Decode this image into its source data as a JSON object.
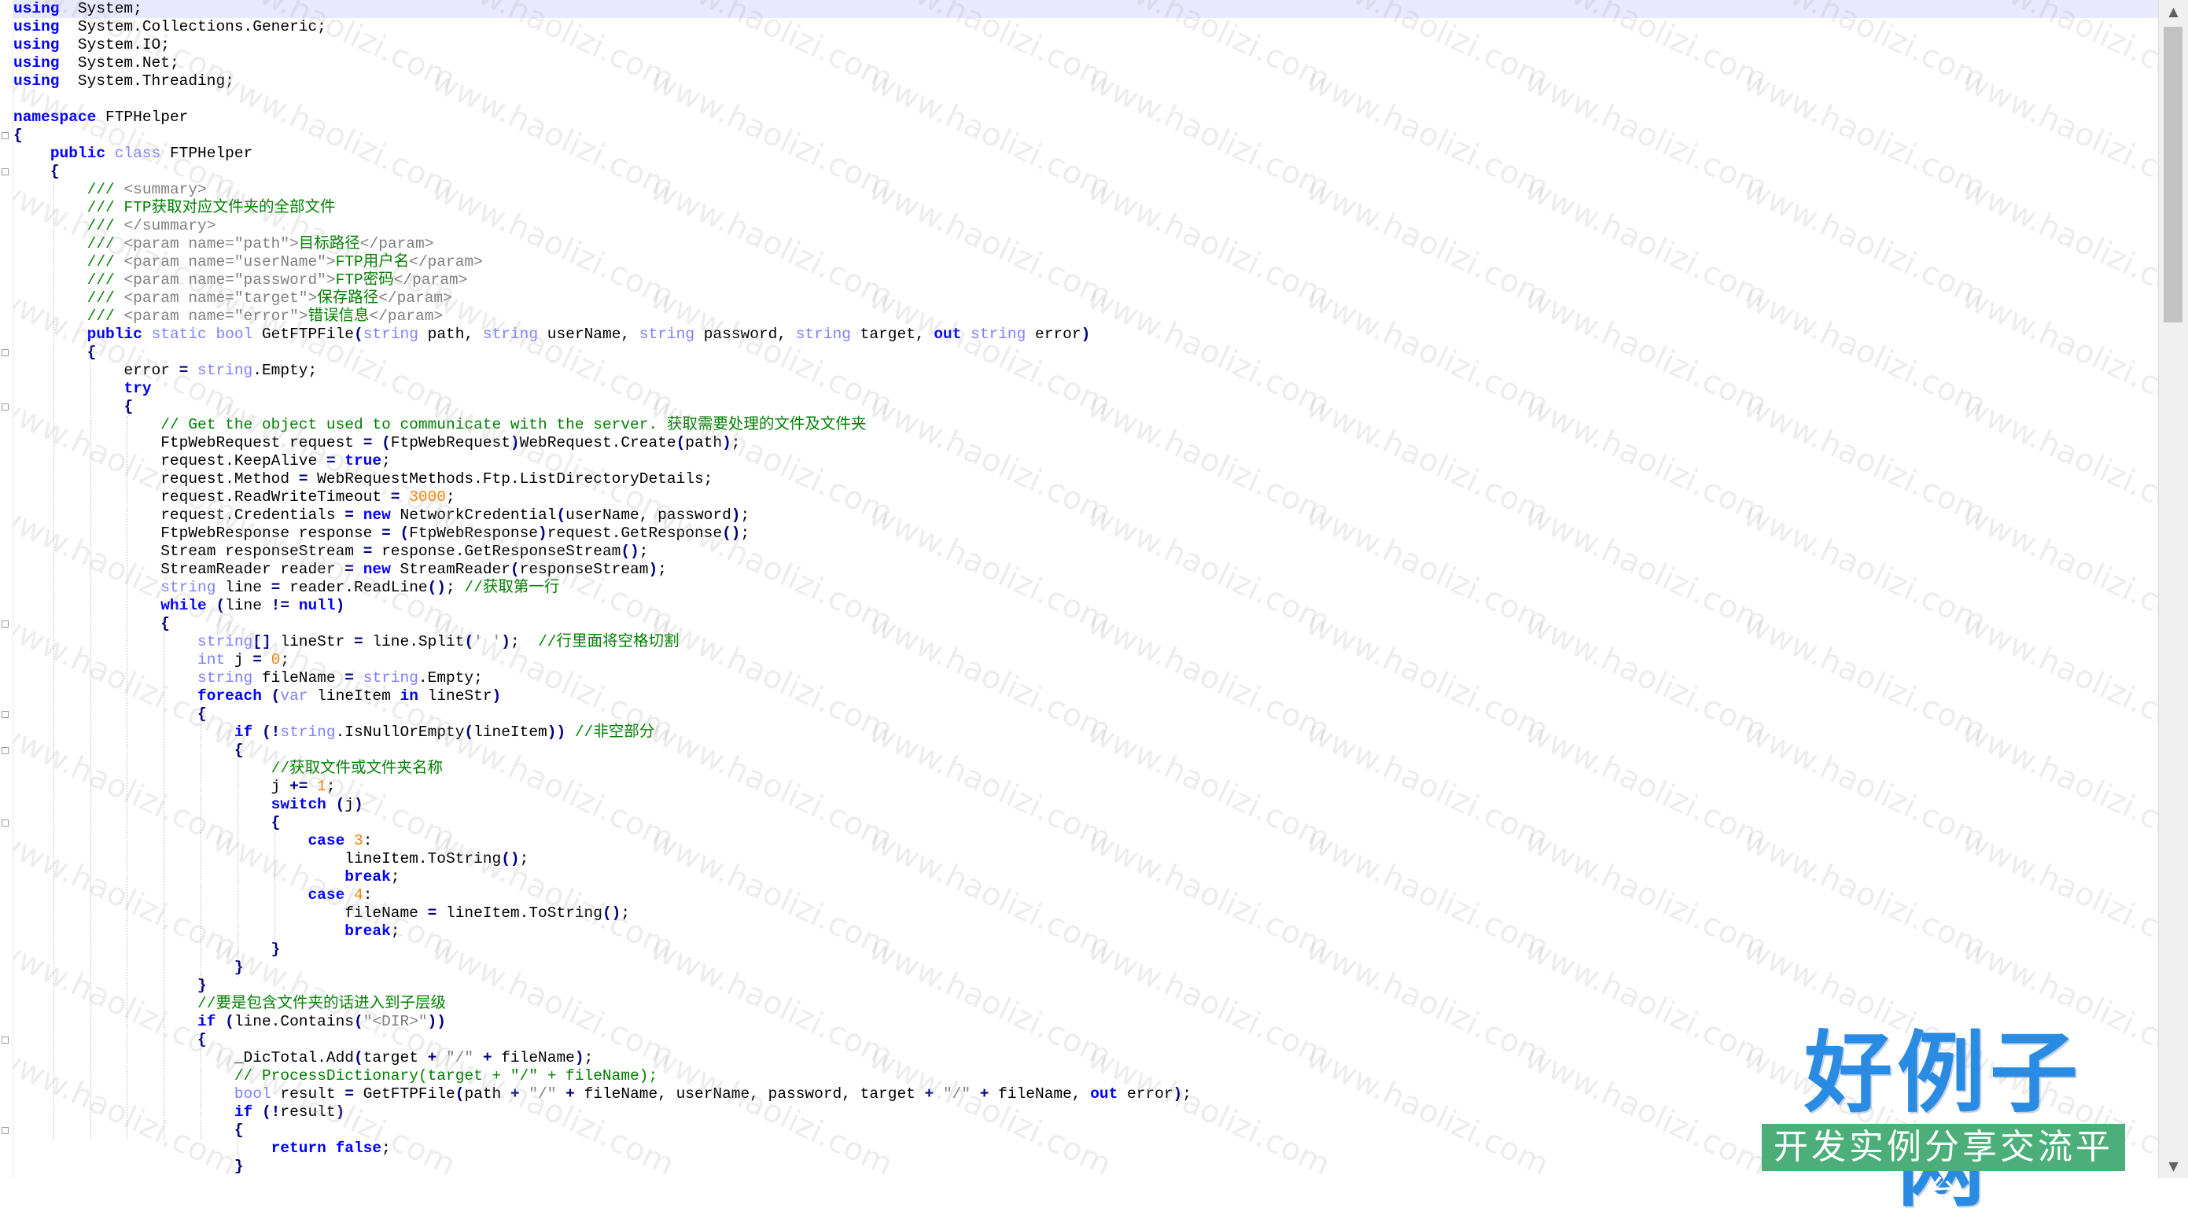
{
  "code_lines": [
    [
      [
        "kw",
        "using"
      ],
      [
        "",
        "  System;"
      ]
    ],
    [
      [
        "kw",
        "using"
      ],
      [
        "",
        "  System.Collections.Generic;"
      ]
    ],
    [
      [
        "kw",
        "using"
      ],
      [
        "",
        "  System.IO;"
      ]
    ],
    [
      [
        "kw",
        "using"
      ],
      [
        "",
        "  System.Net;"
      ]
    ],
    [
      [
        "kw",
        "using"
      ],
      [
        "",
        "  System.Threading;"
      ]
    ],
    [],
    [
      [
        "kw",
        "namespace"
      ],
      [
        "",
        " FTPHelper"
      ]
    ],
    [
      [
        "op",
        "{"
      ]
    ],
    [
      [
        "",
        "    "
      ],
      [
        "kw",
        "public"
      ],
      [
        "",
        " "
      ],
      [
        "ty",
        "class"
      ],
      [
        "",
        " FTPHelper"
      ]
    ],
    [
      [
        "",
        "    "
      ],
      [
        "op",
        "{"
      ]
    ],
    [
      [
        "",
        "        "
      ],
      [
        "cm",
        "/// "
      ],
      [
        "tag",
        "<summary>"
      ]
    ],
    [
      [
        "",
        "        "
      ],
      [
        "cm",
        "/// FTP获取对应文件夹的全部文件"
      ]
    ],
    [
      [
        "",
        "        "
      ],
      [
        "cm",
        "/// "
      ],
      [
        "tag",
        "</summary>"
      ]
    ],
    [
      [
        "",
        "        "
      ],
      [
        "cm",
        "/// "
      ],
      [
        "tag",
        "<param name=\"path\">"
      ],
      [
        "cm",
        "目标路径"
      ],
      [
        "tag",
        "</param>"
      ]
    ],
    [
      [
        "",
        "        "
      ],
      [
        "cm",
        "/// "
      ],
      [
        "tag",
        "<param name=\"userName\">"
      ],
      [
        "cm",
        "FTP用户名"
      ],
      [
        "tag",
        "</param>"
      ]
    ],
    [
      [
        "",
        "        "
      ],
      [
        "cm",
        "/// "
      ],
      [
        "tag",
        "<param name=\"password\">"
      ],
      [
        "cm",
        "FTP密码"
      ],
      [
        "tag",
        "</param>"
      ]
    ],
    [
      [
        "",
        "        "
      ],
      [
        "cm",
        "/// "
      ],
      [
        "tag",
        "<param name=\"target\">"
      ],
      [
        "cm",
        "保存路径"
      ],
      [
        "tag",
        "</param>"
      ]
    ],
    [
      [
        "",
        "        "
      ],
      [
        "cm",
        "/// "
      ],
      [
        "tag",
        "<param name=\"error\">"
      ],
      [
        "cm",
        "错误信息"
      ],
      [
        "tag",
        "</param>"
      ]
    ],
    [
      [
        "",
        "        "
      ],
      [
        "kw",
        "public"
      ],
      [
        "",
        " "
      ],
      [
        "ty",
        "static"
      ],
      [
        "",
        " "
      ],
      [
        "ty",
        "bool"
      ],
      [
        "",
        " GetFTPFile"
      ],
      [
        "op",
        "("
      ],
      [
        "ty",
        "string"
      ],
      [
        "",
        " path, "
      ],
      [
        "ty",
        "string"
      ],
      [
        "",
        " userName, "
      ],
      [
        "ty",
        "string"
      ],
      [
        "",
        " password, "
      ],
      [
        "ty",
        "string"
      ],
      [
        "",
        " target, "
      ],
      [
        "kw",
        "out"
      ],
      [
        "",
        " "
      ],
      [
        "ty",
        "string"
      ],
      [
        "",
        " error"
      ],
      [
        "op",
        ")"
      ]
    ],
    [
      [
        "",
        "        "
      ],
      [
        "op",
        "{"
      ]
    ],
    [
      [
        "",
        "            error "
      ],
      [
        "op",
        "="
      ],
      [
        "",
        " "
      ],
      [
        "ty",
        "string"
      ],
      [
        "",
        ".Empty;"
      ]
    ],
    [
      [
        "",
        "            "
      ],
      [
        "kw",
        "try"
      ]
    ],
    [
      [
        "",
        "            "
      ],
      [
        "op",
        "{"
      ]
    ],
    [
      [
        "",
        "                "
      ],
      [
        "cm",
        "// Get the object used to communicate with the server. 获取需要处理的文件及文件夹"
      ]
    ],
    [
      [
        "",
        "                FtpWebRequest request "
      ],
      [
        "op",
        "="
      ],
      [
        "",
        " "
      ],
      [
        "op",
        "("
      ],
      [
        "",
        "FtpWebRequest"
      ],
      [
        "op",
        ")"
      ],
      [
        "",
        "WebRequest.Create"
      ],
      [
        "op",
        "("
      ],
      [
        "",
        "path"
      ],
      [
        "op",
        ")"
      ],
      [
        "",
        ";"
      ]
    ],
    [
      [
        "",
        "                request.KeepAlive "
      ],
      [
        "op",
        "="
      ],
      [
        "",
        " "
      ],
      [
        "kw",
        "true"
      ],
      [
        "",
        ";"
      ]
    ],
    [
      [
        "",
        "                request.Method "
      ],
      [
        "op",
        "="
      ],
      [
        "",
        " WebRequestMethods.Ftp.ListDirectoryDetails;"
      ]
    ],
    [
      [
        "",
        "                request.ReadWriteTimeout "
      ],
      [
        "op",
        "="
      ],
      [
        "",
        " "
      ],
      [
        "num",
        "3000"
      ],
      [
        "",
        ";"
      ]
    ],
    [
      [
        "",
        "                request.Credentials "
      ],
      [
        "op",
        "="
      ],
      [
        "",
        " "
      ],
      [
        "kw",
        "new"
      ],
      [
        "",
        " NetworkCredential"
      ],
      [
        "op",
        "("
      ],
      [
        "",
        "userName, password"
      ],
      [
        "op",
        ")"
      ],
      [
        "",
        ";"
      ]
    ],
    [
      [
        "",
        "                FtpWebResponse response "
      ],
      [
        "op",
        "="
      ],
      [
        "",
        " "
      ],
      [
        "op",
        "("
      ],
      [
        "",
        "FtpWebResponse"
      ],
      [
        "op",
        ")"
      ],
      [
        "",
        "request.GetResponse"
      ],
      [
        "op",
        "()"
      ],
      [
        "",
        ";"
      ]
    ],
    [
      [
        "",
        "                Stream responseStream "
      ],
      [
        "op",
        "="
      ],
      [
        "",
        " response.GetResponseStream"
      ],
      [
        "op",
        "()"
      ],
      [
        "",
        ";"
      ]
    ],
    [
      [
        "",
        "                StreamReader reader "
      ],
      [
        "op",
        "="
      ],
      [
        "",
        " "
      ],
      [
        "kw",
        "new"
      ],
      [
        "",
        " StreamReader"
      ],
      [
        "op",
        "("
      ],
      [
        "",
        "responseStream"
      ],
      [
        "op",
        ")"
      ],
      [
        "",
        ";"
      ]
    ],
    [
      [
        "",
        "                "
      ],
      [
        "ty",
        "string"
      ],
      [
        "",
        " line "
      ],
      [
        "op",
        "="
      ],
      [
        "",
        " reader.ReadLine"
      ],
      [
        "op",
        "()"
      ],
      [
        "",
        "; "
      ],
      [
        "cm",
        "//获取第一行"
      ]
    ],
    [
      [
        "",
        "                "
      ],
      [
        "kw",
        "while"
      ],
      [
        "",
        " "
      ],
      [
        "op",
        "("
      ],
      [
        "",
        "line "
      ],
      [
        "op",
        "!="
      ],
      [
        "",
        " "
      ],
      [
        "kw",
        "null"
      ],
      [
        "op",
        ")"
      ]
    ],
    [
      [
        "",
        "                "
      ],
      [
        "op",
        "{"
      ]
    ],
    [
      [
        "",
        "                    "
      ],
      [
        "ty",
        "string"
      ],
      [
        "op",
        "[]"
      ],
      [
        "",
        " lineStr "
      ],
      [
        "op",
        "="
      ],
      [
        "",
        " line.Split"
      ],
      [
        "op",
        "("
      ],
      [
        "str",
        "' '"
      ],
      [
        "op",
        ")"
      ],
      [
        "",
        ";  "
      ],
      [
        "cm",
        "//行里面将空格切割"
      ]
    ],
    [
      [
        "",
        "                    "
      ],
      [
        "ty",
        "int"
      ],
      [
        "",
        " j "
      ],
      [
        "op",
        "="
      ],
      [
        "",
        " "
      ],
      [
        "num",
        "0"
      ],
      [
        "",
        ";"
      ]
    ],
    [
      [
        "",
        "                    "
      ],
      [
        "ty",
        "string"
      ],
      [
        "",
        " fileName "
      ],
      [
        "op",
        "="
      ],
      [
        "",
        " "
      ],
      [
        "ty",
        "string"
      ],
      [
        "",
        ".Empty;"
      ]
    ],
    [
      [
        "",
        "                    "
      ],
      [
        "kw",
        "foreach"
      ],
      [
        "",
        " "
      ],
      [
        "op",
        "("
      ],
      [
        "ty",
        "var"
      ],
      [
        "",
        " lineItem "
      ],
      [
        "kw",
        "in"
      ],
      [
        "",
        " lineStr"
      ],
      [
        "op",
        ")"
      ]
    ],
    [
      [
        "",
        "                    "
      ],
      [
        "op",
        "{"
      ]
    ],
    [
      [
        "",
        "                        "
      ],
      [
        "kw",
        "if"
      ],
      [
        "",
        " "
      ],
      [
        "op",
        "(!"
      ],
      [
        "ty",
        "string"
      ],
      [
        "",
        ".IsNullOrEmpty"
      ],
      [
        "op",
        "("
      ],
      [
        "",
        "lineItem"
      ],
      [
        "op",
        "))"
      ],
      [
        "",
        " "
      ],
      [
        "cm",
        "//非空部分"
      ]
    ],
    [
      [
        "",
        "                        "
      ],
      [
        "op",
        "{"
      ]
    ],
    [
      [
        "",
        "                            "
      ],
      [
        "cm",
        "//获取文件或文件夹名称"
      ]
    ],
    [
      [
        "",
        "                            j "
      ],
      [
        "op",
        "+="
      ],
      [
        "",
        " "
      ],
      [
        "num",
        "1"
      ],
      [
        "",
        ";"
      ]
    ],
    [
      [
        "",
        "                            "
      ],
      [
        "kw",
        "switch"
      ],
      [
        "",
        " "
      ],
      [
        "op",
        "("
      ],
      [
        "",
        "j"
      ],
      [
        "op",
        ")"
      ]
    ],
    [
      [
        "",
        "                            "
      ],
      [
        "op",
        "{"
      ]
    ],
    [
      [
        "",
        "                                "
      ],
      [
        "kw",
        "case"
      ],
      [
        "",
        " "
      ],
      [
        "num",
        "3"
      ],
      [
        "",
        ":"
      ]
    ],
    [
      [
        "",
        "                                    lineItem.ToString"
      ],
      [
        "op",
        "()"
      ],
      [
        "",
        ";"
      ]
    ],
    [
      [
        "",
        "                                    "
      ],
      [
        "kw",
        "break"
      ],
      [
        "",
        ";"
      ]
    ],
    [
      [
        "",
        "                                "
      ],
      [
        "kw",
        "case"
      ],
      [
        "",
        " "
      ],
      [
        "num",
        "4"
      ],
      [
        "",
        ":"
      ]
    ],
    [
      [
        "",
        "                                    fileName "
      ],
      [
        "op",
        "="
      ],
      [
        "",
        " lineItem.ToString"
      ],
      [
        "op",
        "()"
      ],
      [
        "",
        ";"
      ]
    ],
    [
      [
        "",
        "                                    "
      ],
      [
        "kw",
        "break"
      ],
      [
        "",
        ";"
      ]
    ],
    [
      [
        "",
        "                            "
      ],
      [
        "op",
        "}"
      ]
    ],
    [
      [
        "",
        "                        "
      ],
      [
        "op",
        "}"
      ]
    ],
    [
      [
        "",
        "                    "
      ],
      [
        "op",
        "}"
      ]
    ],
    [
      [
        "",
        "                    "
      ],
      [
        "cm",
        "//要是包含文件夹的话进入到子层级"
      ]
    ],
    [
      [
        "",
        "                    "
      ],
      [
        "kw",
        "if"
      ],
      [
        "",
        " "
      ],
      [
        "op",
        "("
      ],
      [
        "",
        "line.Contains"
      ],
      [
        "op",
        "("
      ],
      [
        "str",
        "\"<DIR>\""
      ],
      [
        "op",
        "))"
      ]
    ],
    [
      [
        "",
        "                    "
      ],
      [
        "op",
        "{"
      ]
    ],
    [
      [
        "",
        "                        _DicTotal.Add"
      ],
      [
        "op",
        "("
      ],
      [
        "",
        "target "
      ],
      [
        "op",
        "+"
      ],
      [
        "",
        " "
      ],
      [
        "str",
        "\"/\""
      ],
      [
        "",
        " "
      ],
      [
        "op",
        "+"
      ],
      [
        "",
        " fileName"
      ],
      [
        "op",
        ")"
      ],
      [
        "",
        ";"
      ]
    ],
    [
      [
        "",
        "                        "
      ],
      [
        "cm",
        "// ProcessDictionary(target + \"/\" + fileName);"
      ]
    ],
    [
      [
        "",
        "                        "
      ],
      [
        "ty",
        "bool"
      ],
      [
        "",
        " result "
      ],
      [
        "op",
        "="
      ],
      [
        "",
        " GetFTPFile"
      ],
      [
        "op",
        "("
      ],
      [
        "",
        "path "
      ],
      [
        "op",
        "+"
      ],
      [
        "",
        " "
      ],
      [
        "str",
        "\"/\""
      ],
      [
        "",
        " "
      ],
      [
        "op",
        "+"
      ],
      [
        "",
        " fileName, userName, password, target "
      ],
      [
        "op",
        "+"
      ],
      [
        "",
        " "
      ],
      [
        "str",
        "\"/\""
      ],
      [
        "",
        " "
      ],
      [
        "op",
        "+"
      ],
      [
        "",
        " fileName, "
      ],
      [
        "kw",
        "out"
      ],
      [
        "",
        " error"
      ],
      [
        "op",
        ")"
      ],
      [
        "",
        ";"
      ]
    ],
    [
      [
        "",
        "                        "
      ],
      [
        "kw",
        "if"
      ],
      [
        "",
        " "
      ],
      [
        "op",
        "(!"
      ],
      [
        "",
        "result"
      ],
      [
        "op",
        ")"
      ]
    ],
    [
      [
        "",
        "                        "
      ],
      [
        "op",
        "{"
      ]
    ],
    [
      [
        "",
        "                            "
      ],
      [
        "kw",
        "return"
      ],
      [
        "",
        " "
      ],
      [
        "kw",
        "false"
      ],
      [
        "",
        ";"
      ]
    ],
    [
      [
        "",
        "                        "
      ],
      [
        "op",
        "}"
      ]
    ]
  ],
  "watermark_text": "www.haolizi.com",
  "logo": {
    "title": "好例子网",
    "subtitle": "开发实例分享交流平台"
  },
  "scrollbar": {
    "up_arrow": "▲",
    "down_arrow": "▼"
  },
  "colors": {
    "keyword": "#0000ff",
    "type": "#8080ff",
    "comment": "#008000",
    "string": "#808080",
    "number": "#ff8000",
    "operator": "#000080",
    "current_line": "#e8e8ff",
    "logo_blue": "#2a8be3",
    "logo_green": "#4caf7a"
  }
}
